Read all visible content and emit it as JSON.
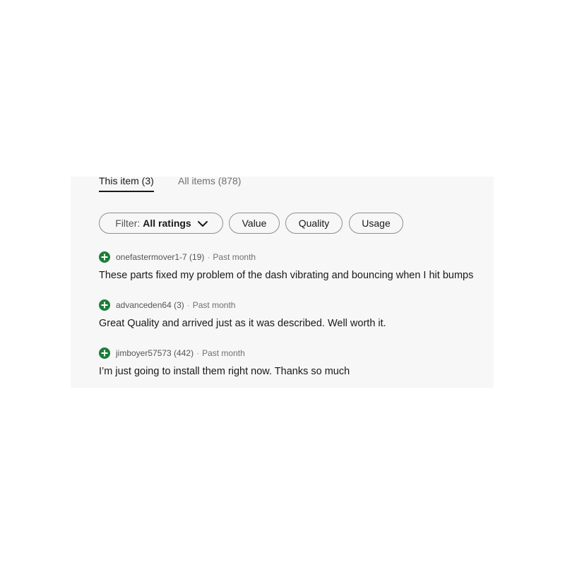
{
  "tabs": [
    {
      "label": "This item (3)",
      "active": true
    },
    {
      "label": "All items (878)",
      "active": false
    }
  ],
  "filters": {
    "filter_prefix": "Filter:",
    "filter_value": "All ratings",
    "chips": [
      "Value",
      "Quality",
      "Usage"
    ]
  },
  "reviews": [
    {
      "user": "onefastermover1-7 (19)",
      "separator": "·",
      "time": "Past month",
      "text": "These parts fixed my problem of the dash vibrating and bouncing when I hit bumps"
    },
    {
      "user": "advanceden64 (3)",
      "separator": "·",
      "time": "Past month",
      "text": "Great Quality and arrived just as it was described. Well worth it."
    },
    {
      "user": "jimboyer57573 (442)",
      "separator": "·",
      "time": "Past month",
      "text": "I’m just going to install them right now. Thanks so much"
    }
  ],
  "colors": {
    "panel_bg": "#f7f7f7",
    "positive_icon": "#1a7f37",
    "text": "#191919",
    "muted": "#707070"
  },
  "icons": {
    "positive": "plus-circle-icon",
    "dropdown": "chevron-down-icon"
  }
}
